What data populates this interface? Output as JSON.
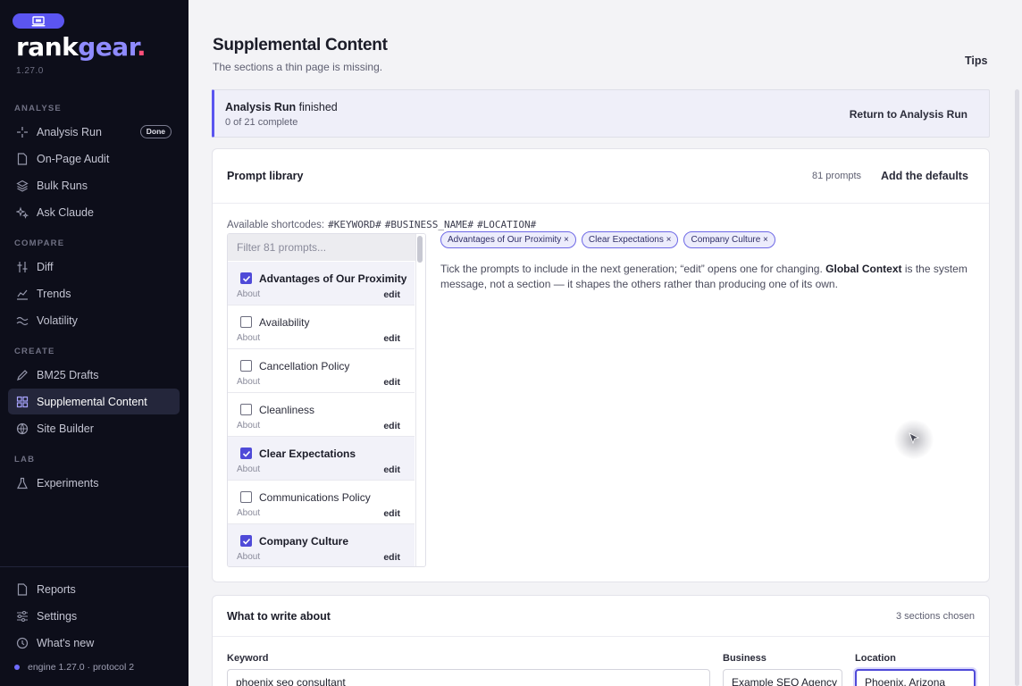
{
  "brand": {
    "logo_rank": "rank",
    "logo_gear": "gear",
    "logo_dot": ".",
    "version": "1.27.0"
  },
  "sidebar": {
    "sections": {
      "analyse": "ANALYSE",
      "compare": "COMPARE",
      "create": "CREATE",
      "lab": "LAB"
    },
    "items": {
      "analysis_run": "Analysis Run",
      "analysis_run_badge": "Done",
      "onpage_audit": "On-Page Audit",
      "bulk_runs": "Bulk Runs",
      "ask_claude": "Ask Claude",
      "diff": "Diff",
      "trends": "Trends",
      "volatility": "Volatility",
      "bm25_drafts": "BM25 Drafts",
      "supplemental_content": "Supplemental Content",
      "site_builder": "Site Builder",
      "experiments": "Experiments",
      "reports": "Reports",
      "settings": "Settings",
      "whats_new": "What's new"
    },
    "engine_status": "engine 1.27.0 · protocol 2"
  },
  "header": {
    "title": "Supplemental Content",
    "subtitle": "The sections a thin page is missing.",
    "tips": "Tips"
  },
  "banner": {
    "bold": "Analysis Run",
    "rest": " finished",
    "progress": "0 of 21 complete",
    "action": "Return to Analysis Run"
  },
  "library": {
    "title": "Prompt library",
    "count": "81 prompts",
    "add_defaults": "Add the defaults",
    "shortcodes_label": "Available shortcodes:",
    "shortcodes": [
      "#KEYWORD#",
      "#BUSINESS_NAME#",
      "#LOCATION#"
    ],
    "filter_placeholder": "Filter 81 prompts...",
    "prompts": [
      {
        "name": "Advantages of Our Proximity",
        "category": "About",
        "edit": "edit",
        "checked": true
      },
      {
        "name": "Availability",
        "category": "About",
        "edit": "edit",
        "checked": false
      },
      {
        "name": "Cancellation Policy",
        "category": "About",
        "edit": "edit",
        "checked": false
      },
      {
        "name": "Cleanliness",
        "category": "About",
        "edit": "edit",
        "checked": false
      },
      {
        "name": "Clear Expectations",
        "category": "About",
        "edit": "edit",
        "checked": true
      },
      {
        "name": "Communications Policy",
        "category": "About",
        "edit": "edit",
        "checked": false
      },
      {
        "name": "Company Culture",
        "category": "About",
        "edit": "edit",
        "checked": true
      }
    ],
    "chips": [
      "Advantages of Our Proximity ×",
      "Clear Expectations ×",
      "Company Culture ×"
    ],
    "desc_1": "Tick the prompts to include in the next generation; “edit” opens one for changing. ",
    "desc_bold": "Global Context",
    "desc_2": " is the system message, not a section — it shapes the others rather than producing one of its own."
  },
  "write": {
    "title": "What to write about",
    "count": "3 sections chosen",
    "keyword_label": "Keyword",
    "keyword_value": "phoenix seo consultant",
    "business_label": "Business",
    "business_value": "Example SEO Agency",
    "location_label": "Location",
    "location_value": "Phoenix, Arizona"
  },
  "colors": {
    "accent": "#5b55f0",
    "sidebar_bg": "#0d0e1a",
    "check": "#4f4ad8"
  }
}
